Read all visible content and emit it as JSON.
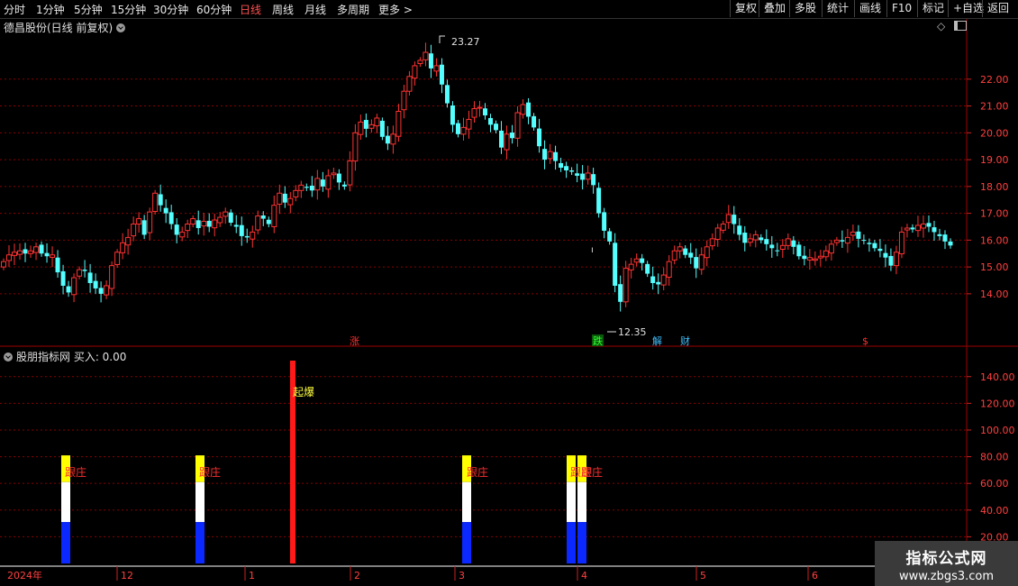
{
  "toolbar": {
    "timeframes": [
      "分时",
      "1分钟",
      "5分钟",
      "15分钟",
      "30分钟",
      "60分钟",
      "日线",
      "周线",
      "月线",
      "多周期",
      "更多 >"
    ],
    "active": "日线",
    "right_buttons": [
      "复权",
      "叠加",
      "多股",
      "统计",
      "画线",
      "F10",
      "标记",
      "+自选",
      "返回"
    ]
  },
  "main_panel": {
    "title": "德昌股份(日线 前复权)",
    "high_label": "23.27",
    "low_label": "12.35",
    "event_markers": [
      {
        "text": "涨",
        "color": "#ff3030"
      },
      {
        "text": "跌",
        "color": "#30ff30"
      },
      {
        "text": "解",
        "color": "#40c0ff"
      },
      {
        "text": "财",
        "color": "#40c0ff"
      },
      {
        "text": "$",
        "color": "#ff3030"
      }
    ]
  },
  "indicator_panel": {
    "title": "股朋指标网 买入: 0.00",
    "labels": {
      "qibao": "起爆",
      "genzhuang": "跟庄"
    }
  },
  "time_axis": [
    "2024年",
    "12",
    "1",
    "2",
    "3",
    "4",
    "5",
    "6"
  ],
  "watermark": {
    "line1": "指标公式网",
    "line2": "www.zbgs3.com"
  },
  "colors": {
    "up": "#ff3232",
    "down": "#54ffff",
    "grid": "#8b0000",
    "volume_blue": "#0a28ff",
    "signal_yellow": "#ffff00",
    "signal_red": "#ff1a1a"
  },
  "chart_data": {
    "type": "candlestick",
    "y_ticks": [
      14.0,
      15.0,
      16.0,
      17.0,
      18.0,
      19.0,
      20.0,
      21.0,
      22.0
    ],
    "ylim": [
      12.35,
      23.27
    ],
    "closes": [
      15.2,
      15.45,
      15.55,
      15.6,
      15.5,
      15.6,
      15.75,
      15.5,
      15.4,
      15.45,
      14.8,
      14.3,
      14.05,
      14.6,
      14.9,
      14.85,
      14.4,
      14.2,
      14.0,
      14.3,
      15.05,
      15.55,
      15.9,
      16.1,
      16.6,
      16.8,
      16.2,
      17.05,
      17.75,
      17.3,
      17.0,
      16.6,
      16.2,
      16.3,
      16.6,
      16.8,
      16.45,
      16.7,
      16.5,
      16.75,
      16.85,
      17.05,
      16.65,
      16.5,
      16.15,
      16.1,
      16.3,
      16.9,
      16.8,
      16.6,
      17.3,
      17.75,
      17.4,
      17.55,
      17.85,
      18.05,
      17.95,
      17.85,
      18.3,
      18.0,
      18.4,
      18.5,
      18.15,
      18.0,
      18.95,
      20.0,
      20.4,
      20.15,
      20.3,
      20.55,
      19.85,
      19.6,
      19.95,
      20.8,
      21.55,
      22.1,
      22.5,
      22.7,
      23.0,
      22.4,
      22.5,
      21.8,
      21.1,
      20.3,
      19.95,
      20.2,
      20.5,
      20.9,
      20.95,
      20.65,
      20.3,
      20.1,
      19.45,
      19.95,
      19.8,
      20.75,
      21.05,
      20.6,
      20.2,
      19.5,
      19.0,
      19.3,
      18.95,
      18.7,
      18.6,
      18.55,
      18.4,
      18.25,
      18.5,
      18.05,
      17.0,
      16.35,
      15.95,
      14.3,
      13.7,
      14.95,
      15.1,
      15.3,
      15.15,
      14.75,
      14.4,
      14.35,
      14.7,
      15.2,
      15.6,
      15.75,
      15.45,
      15.35,
      14.95,
      15.45,
      15.75,
      16.05,
      16.45,
      16.6,
      16.95,
      16.6,
      16.2,
      15.9,
      16.05,
      16.2,
      16.0,
      15.85,
      15.7,
      15.6,
      15.8,
      16.05,
      15.75,
      15.4,
      15.3,
      15.35,
      15.3,
      15.4,
      15.6,
      15.85,
      16.0,
      15.95,
      16.1,
      16.3,
      16.05,
      16.0,
      15.85,
      15.7,
      15.6,
      15.35,
      15.05,
      15.55,
      16.3,
      16.45,
      16.4,
      16.55,
      16.6,
      16.5,
      16.3,
      16.15,
      15.95,
      15.8
    ],
    "time_labels": [
      "2024年",
      "12",
      "1",
      "2",
      "3",
      "4",
      "5",
      "6"
    ],
    "indicator": {
      "y_ticks": [
        20.0,
        40.0,
        60.0,
        80.0,
        100.0,
        120.0,
        140.0
      ],
      "ylim": [
        0,
        160
      ],
      "qibao_value": 152,
      "genzhuang_levels": {
        "blue": 31,
        "white": 61,
        "yellow": 81
      }
    }
  }
}
